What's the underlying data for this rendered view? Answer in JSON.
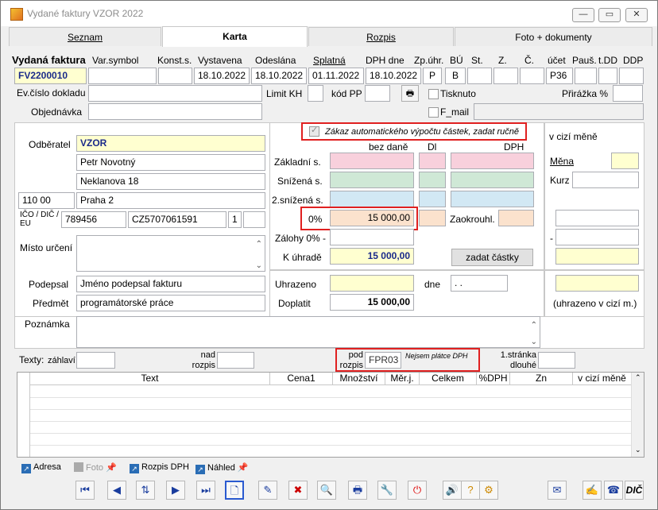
{
  "window": {
    "title": "Vydané faktury VZOR 2022",
    "min": "—",
    "max": "▭",
    "close": "✕"
  },
  "tabs": [
    {
      "label": "Seznam"
    },
    {
      "label": "Karta"
    },
    {
      "label": "Rozpis"
    },
    {
      "label": "Foto + dokumenty"
    }
  ],
  "header": {
    "labels": {
      "doc": "Vydaná faktura",
      "varsym": "Var.symbol",
      "konst": "Konst.s.",
      "vystavena": "Vystavena",
      "odeslana": "Odeslána",
      "splatna": "Splatná",
      "dph_dne": "DPH dne",
      "zpuhr": "Zp.úhr.",
      "bu": "BÚ",
      "st": "St.",
      "z": "Z.",
      "c": "Č.",
      "ucet": "účet",
      "paus": "Pauš.",
      "tdd": "t.DD",
      "ddp": "DDP"
    },
    "values": {
      "doc": "FV2200010",
      "varsym": "",
      "konst": "",
      "vystavena": "18.10.2022",
      "odeslana": "18.10.2022",
      "splatna": "01.11.2022",
      "dph_dne": "18.10.2022",
      "zpuhr": "P",
      "bu": "B",
      "ucet": "P36"
    },
    "evcislo_label": "Ev.číslo dokladu",
    "limit_kh_label": "Limit KH",
    "kod_pp_label": "kód PP",
    "prirazka_label": "Přirážka %",
    "objednavka_label": "Objednávka",
    "tisknuto_label": "Tisknuto",
    "fmail_label": "F_mail"
  },
  "customer": {
    "odberatel_label": "Odběratel",
    "name": "VZOR",
    "person": "Petr Novotný",
    "street": "Neklanova 18",
    "zip": "110 00",
    "city": "Praha 2",
    "ico_label": "IČO / DIČ / EU",
    "ico": "789456",
    "dic": "CZ5707061591",
    "eu": "1",
    "misto_label": "Místo určení",
    "podepsal_label": "Podepsal",
    "podepsal": "Jméno podepsal fakturu",
    "predmet_label": "Předmět",
    "predmet": "programátorské práce"
  },
  "amounts": {
    "zakaz_label": "Zákaz automatického výpočtu částek, zadat ručně",
    "bez_dane": "bez daně",
    "dl": "Dl",
    "dph": "DPH",
    "zakladni": "Základní s.",
    "snizena": "Snížená s.",
    "snizena2": "2.snížená s.",
    "zero_label": "0%",
    "zero_value": "15 000,00",
    "zaokrouhl": "Zaokrouhl.",
    "zalohy_label": "Zálohy 0% -",
    "k_uhrade_label": "K úhradě",
    "k_uhrade": "15 000,00",
    "zadat_btn": "zadat částky",
    "uhrazeno_label": "Uhrazeno",
    "dne_label": "dne",
    "dne_value": " .  .",
    "doplatit_label": "Doplatit",
    "doplatit": "15 000,00"
  },
  "foreign": {
    "title": "v cizí měně",
    "mena": "Měna",
    "kurz": "Kurz",
    "dash": "-",
    "paid": "(uhrazeno v cizí m.)"
  },
  "notes": {
    "poznamka": "Poznámka",
    "texty": "Texty:",
    "zahlavi": "záhlaví",
    "nad_rozpis": "nad rozpis",
    "pod_rozpis": "pod rozpis",
    "pod_value": "FPR03",
    "nejsem": "Nejsem plátce DPH",
    "stranka": "1.stránka dlouhé"
  },
  "table": {
    "columns": [
      "Text",
      "Cena1",
      "Množství",
      "Měr.j.",
      "Celkem",
      "%DPH",
      "Zn",
      "v cizí měně"
    ]
  },
  "links": [
    {
      "label": "Adresa"
    },
    {
      "label": "Foto"
    },
    {
      "label": "Rozpis DPH"
    },
    {
      "label": "Náhled"
    }
  ],
  "toolbar": {
    "dic": "DIČ"
  }
}
